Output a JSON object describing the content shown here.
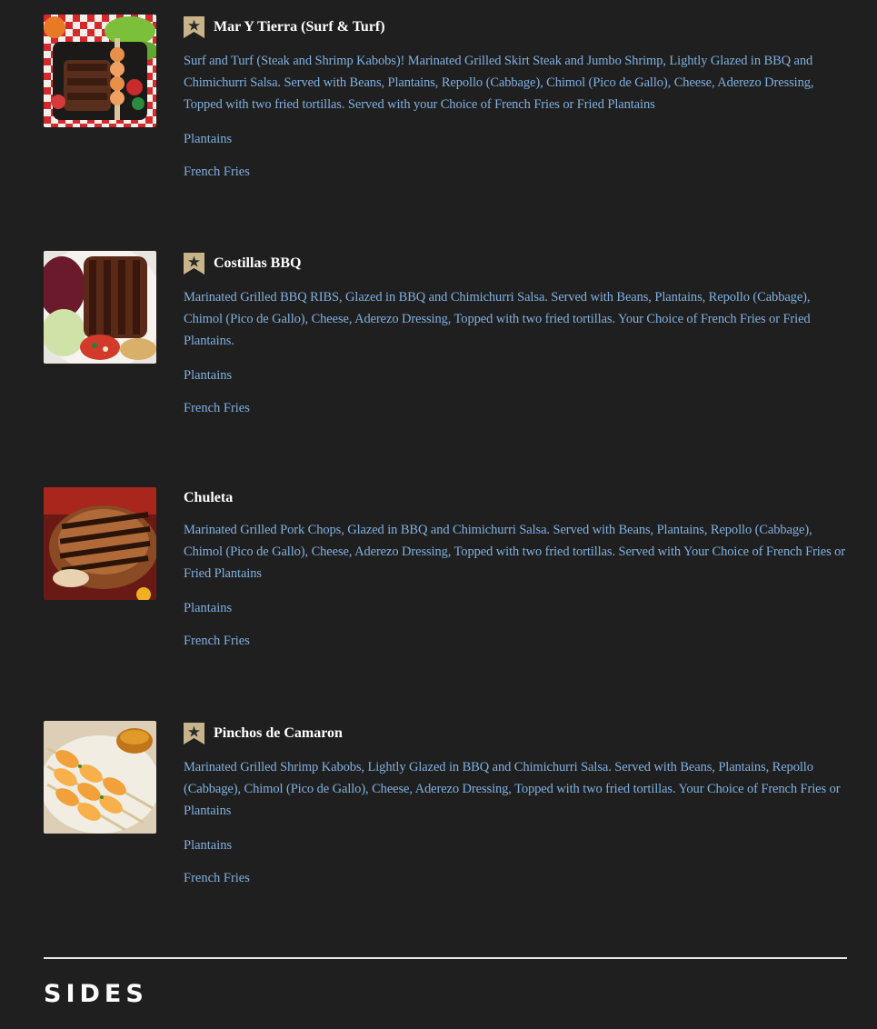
{
  "colors": {
    "background": "#1f1f1f",
    "title": "#ffffff",
    "link_text": "#7fb0e0",
    "badge": "#c8b48a",
    "divider": "#e9e9e9"
  },
  "items": [
    {
      "name": "Mar Y Tierra (Surf & Turf)",
      "featured": true,
      "badge_icon": "star-badge-icon",
      "description": "Surf and Turf (Steak and Shrimp Kabobs)! Marinated Grilled Skirt Steak and Jumbo Shrimp, Lightly Glazed in BBQ and Chimichurri Salsa. Served with Beans, Plantains, Repollo (Cabbage), Chimol (Pico de Gallo), Cheese, Aderezo Dressing, Topped with two fried tortillas. Served with your Choice of French Fries or Fried Plantains",
      "options": [
        "Plantains",
        "French Fries"
      ]
    },
    {
      "name": "Costillas BBQ",
      "featured": true,
      "badge_icon": "star-badge-icon",
      "description": "Marinated Grilled BBQ RIBS, Glazed in BBQ and Chimichurri Salsa. Served with Beans, Plantains, Repollo (Cabbage), Chimol (Pico de Gallo), Cheese, Aderezo Dressing, Topped with two fried tortillas. Your Choice of French Fries or Fried Plantains.",
      "options": [
        "Plantains",
        "French Fries"
      ]
    },
    {
      "name": "Chuleta",
      "featured": false,
      "description": "Marinated Grilled Pork Chops, Glazed in BBQ and Chimichurri Salsa. Served with Beans, Plantains, Repollo (Cabbage), Chimol (Pico de Gallo), Cheese, Aderezo Dressing, Topped with two fried tortillas. Served with Your Choice of French Fries or Fried Plantains",
      "options": [
        "Plantains",
        "French Fries"
      ]
    },
    {
      "name": "Pinchos de Camaron",
      "featured": true,
      "badge_icon": "star-badge-icon",
      "description": "Marinated Grilled Shrimp Kabobs, Lightly Glazed in BBQ and Chimichurri Salsa. Served with Beans, Plantains, Repollo (Cabbage), Chimol (Pico de Gallo), Cheese, Aderezo Dressing, Topped with two fried tortillas. Your Choice of French Fries or Plantains",
      "options": [
        "Plantains",
        "French Fries"
      ]
    }
  ],
  "section": {
    "heading": "SIDES"
  }
}
